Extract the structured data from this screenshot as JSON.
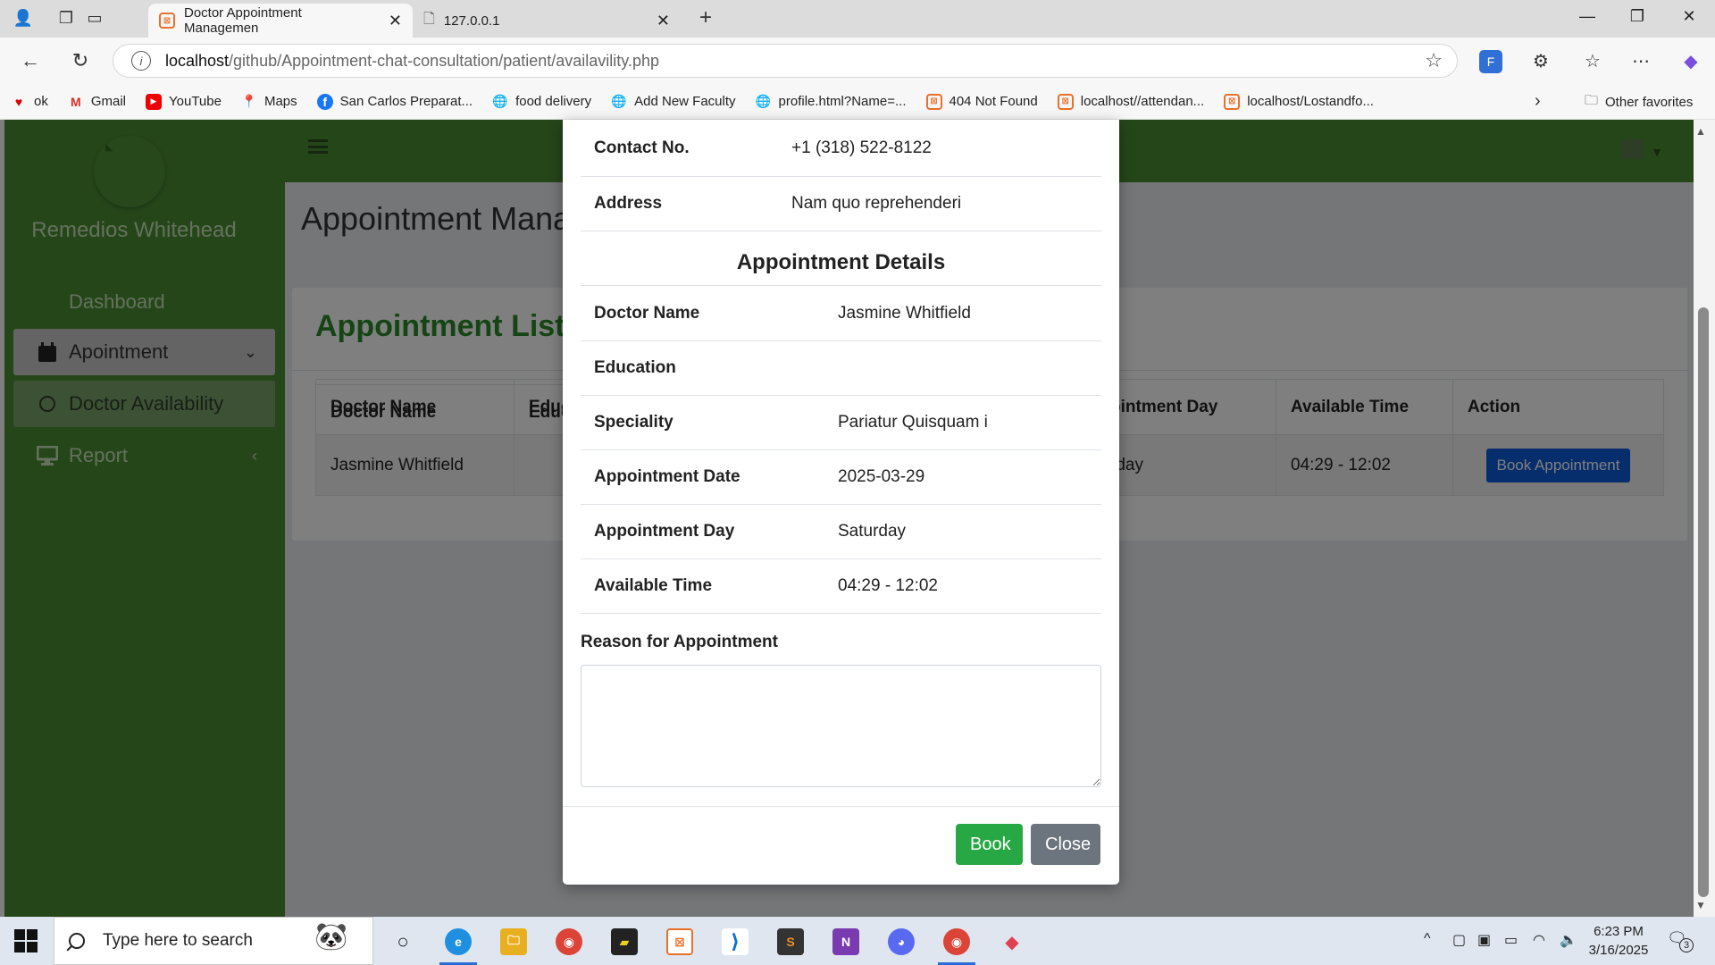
{
  "browser": {
    "tabs": [
      {
        "title": "Doctor Appointment Managemen",
        "active": true
      },
      {
        "title": "127.0.0.1",
        "active": false
      }
    ],
    "url_host": "localhost",
    "url_path": "/github/Appointment-chat-consultation/patient/availavility.php",
    "bookmarks": [
      {
        "label": "ok",
        "icon": "heart-icon"
      },
      {
        "label": "Gmail",
        "icon": "gmail-icon"
      },
      {
        "label": "YouTube",
        "icon": "youtube-icon"
      },
      {
        "label": "Maps",
        "icon": "maps-icon"
      },
      {
        "label": "San Carlos Preparat...",
        "icon": "facebook-icon"
      },
      {
        "label": "food delivery",
        "icon": "globe-icon"
      },
      {
        "label": "Add New Faculty",
        "icon": "globe-icon"
      },
      {
        "label": "profile.html?Name=...",
        "icon": "globe-icon"
      },
      {
        "label": "404 Not Found",
        "icon": "xampp-icon"
      },
      {
        "label": "localhost//attendan...",
        "icon": "xampp-icon"
      },
      {
        "label": "localhost/Lostandfo...",
        "icon": "xampp-icon"
      }
    ],
    "other_favorites": "Other favorites"
  },
  "sidebar": {
    "user_name": "Remedios Whitehead",
    "items": [
      {
        "label": "Dashboard"
      },
      {
        "label": "Apointment"
      },
      {
        "label": "Doctor Availability"
      },
      {
        "label": "Report"
      }
    ]
  },
  "main": {
    "page_title": "Appointment Manag",
    "card_title": "Appointment List",
    "table": {
      "headers": [
        "Doctor Name",
        "Educ",
        "ointment Day",
        "Available Time",
        "Action"
      ],
      "row": {
        "doctor_name": "Jasmine Whitfield",
        "day": "rday",
        "time": "04:29 - 12:02",
        "action_label": "Book Appointment"
      }
    }
  },
  "modal": {
    "patient_rows": [
      {
        "label": "Contact No.",
        "value": "+1 (318) 522-8122"
      },
      {
        "label": "Address",
        "value": "Nam quo reprehenderi"
      }
    ],
    "section_title": "Appointment Details",
    "detail_rows": [
      {
        "label": "Doctor Name",
        "value": "Jasmine Whitfield"
      },
      {
        "label": "Education",
        "value": ""
      },
      {
        "label": "Speciality",
        "value": "Pariatur Quisquam i"
      },
      {
        "label": "Appointment Date",
        "value": "2025-03-29"
      },
      {
        "label": "Appointment Day",
        "value": "Saturday"
      },
      {
        "label": "Available Time",
        "value": "04:29 - 12:02"
      }
    ],
    "reason_label": "Reason for Appointment",
    "reason_value": "",
    "book_label": "Book",
    "close_label": "Close"
  },
  "taskbar": {
    "search_placeholder": "Type here to search",
    "time": "6:23 PM",
    "date": "3/16/2025",
    "notification_count": "3"
  },
  "colors": {
    "sidebar_green": "#4b8c32",
    "card_title_green": "#2b8a2b",
    "book_button": "#28a745",
    "close_button": "#6c757d",
    "book_appointment_button": "#0d5ad9"
  }
}
